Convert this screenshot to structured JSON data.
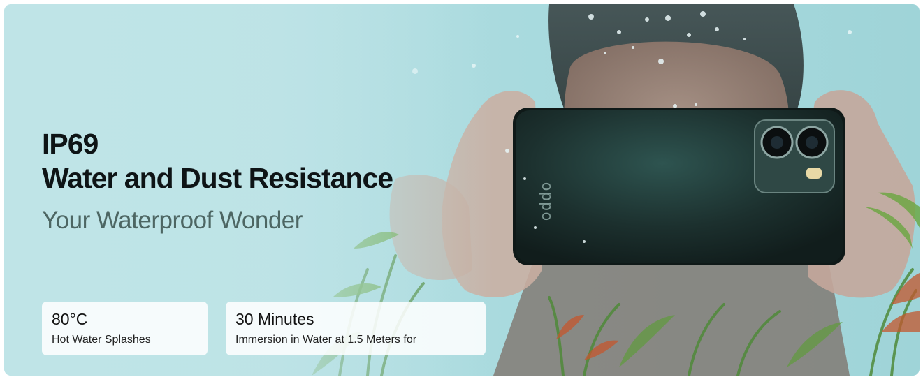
{
  "hero": {
    "title_line1": "IP69",
    "title_line2": "Water and Dust Resistance",
    "subtitle": "Your Waterproof Wonder"
  },
  "phone": {
    "brand_text": "oppo"
  },
  "features": [
    {
      "value": "80°C",
      "description": "Hot Water Splashes"
    },
    {
      "value": "30 Minutes",
      "description": "Immersion in Water at 1.5 Meters for"
    }
  ],
  "colors": {
    "water": "#b8e2e6",
    "phone_body": "#1f3432",
    "title_text": "#0e1416",
    "subtitle_text": "#4d6663"
  }
}
